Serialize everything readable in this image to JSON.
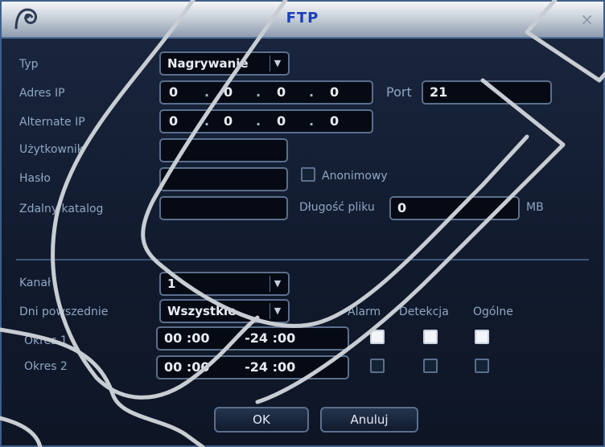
{
  "window": {
    "title": "FTP",
    "close_glyph": "×"
  },
  "form": {
    "typ_label": "Typ",
    "typ_value": "Nagrywanie",
    "adres_label": "Adres IP",
    "adres_ip": [
      "0",
      "0",
      "0",
      "0"
    ],
    "port_label": "Port",
    "port_value": "21",
    "alternate_label": "Alternate IP",
    "alternate_ip": [
      "0",
      "0",
      "0",
      "0"
    ],
    "user_label": "Użytkownik",
    "user_value": "",
    "password_label": "Hasło",
    "password_value": "",
    "anon_label": "Anonimowy",
    "dir_label": "Zdalny katalog",
    "dir_value": "",
    "len_label": "Długość pliku",
    "len_value": "0",
    "len_unit": "MB"
  },
  "schedule": {
    "kanal_label": "Kanał",
    "kanal_value": "1",
    "days_label": "Dni powszednie",
    "days_value": "Wszystkie",
    "col_alarm": "Alarm",
    "col_detect": "Detekcja",
    "col_general": "Ogólne",
    "periods": [
      {
        "label": "Okres 1",
        "start_h": "00",
        "start_m": "00",
        "end_h": "24",
        "end_m": "00",
        "alarm": true,
        "detect": true,
        "general": true
      },
      {
        "label": "Okres 2",
        "start_h": "00",
        "start_m": "00",
        "end_h": "24",
        "end_m": "00",
        "alarm": false,
        "detect": false,
        "general": false
      }
    ]
  },
  "buttons": {
    "ok": "OK",
    "cancel": "Anuluj"
  },
  "icons": {
    "logo": "app-logo-icon",
    "dropdown": "chevron-down-icon",
    "close": "close-icon"
  },
  "colors": {
    "title": "#1a3fb7",
    "label": "#8ea7c4",
    "field_border": "#5b6f8c",
    "background": "#111a2c"
  }
}
